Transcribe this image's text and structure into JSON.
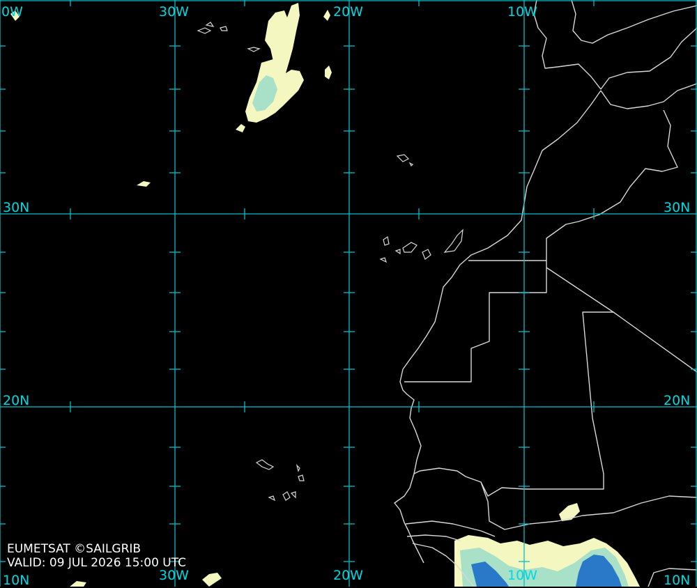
{
  "map": {
    "colors": {
      "background": "#000000",
      "grid": "#00c0c8",
      "grid_label": "#00d8e0",
      "coastline": "#d8d8d8",
      "cloud_light": "#f4f8c0",
      "cloud_mid": "#a8e0c8",
      "cloud_dense": "#2a78c8"
    },
    "grid_labels": {
      "top_w40": "0W",
      "top_w30": "30W",
      "top_w20": "20W",
      "top_w10": "10W",
      "left_30n": "30N",
      "right_30n": "30N",
      "left_20n": "20N",
      "right_20n": "20N",
      "bottom_w30": "30W",
      "bottom_w20": "20W",
      "bottom_w10": "10W",
      "bottom_left_10n": "10N",
      "bottom_right_10n": "10N"
    },
    "credit": {
      "source": "EUMETSAT ©SAILGRIB",
      "valid": "VALID:  09 JUL 2026 15:00 UTC"
    }
  }
}
